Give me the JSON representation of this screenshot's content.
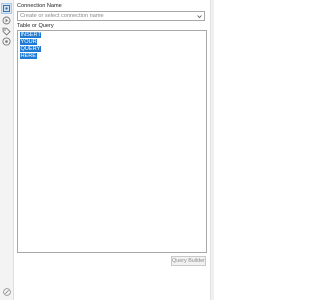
{
  "rail": {
    "icons": [
      "settings-icon",
      "play-icon",
      "tag-icon",
      "options-icon"
    ]
  },
  "connection": {
    "label": "Connection Name",
    "placeholder": "Create or select connection name"
  },
  "query": {
    "label": "Table or Query",
    "lines": [
      "INSERT",
      "YOUR",
      "QUERY",
      "HERE"
    ]
  },
  "buttons": {
    "query_builder": "Query Builder"
  },
  "colors": {
    "selection": "#1e7ad4",
    "border": "#a8a8a8",
    "rail_bg": "#f3f3f3"
  }
}
